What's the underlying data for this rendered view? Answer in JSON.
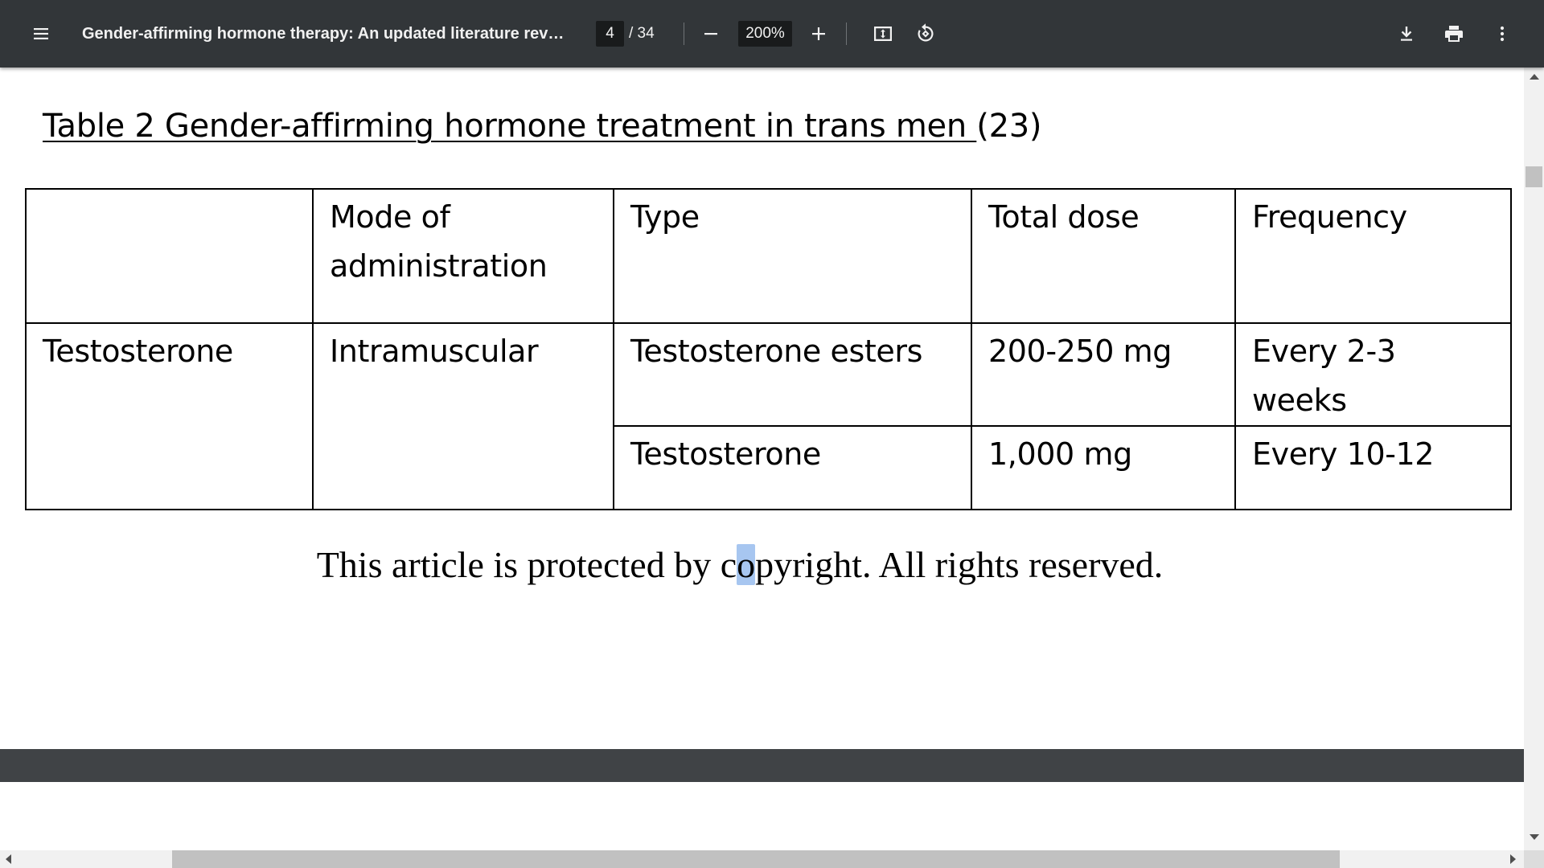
{
  "toolbar": {
    "menu_icon": "hamburger-menu-icon",
    "title": "Gender-affirming hormone therapy: An updated literature revie...",
    "page_current": "4",
    "page_total": "/ 34",
    "zoom_out_icon": "minus-icon",
    "zoom_value": "200%",
    "zoom_in_icon": "plus-icon",
    "fit_icon": "fit-to-page-icon",
    "rotate_icon": "rotate-counterclockwise-icon",
    "download_icon": "download-icon",
    "print_icon": "print-icon",
    "more_icon": "more-vertical-icon"
  },
  "document": {
    "caption_underlined": "Table 2 Gender-affirming hormone treatment in trans men ",
    "caption_ref": "(23)",
    "table": {
      "headers": [
        "",
        "Mode of administration",
        "Type",
        "Total dose",
        "Frequency"
      ],
      "rows": [
        {
          "hormone": "Testosterone",
          "mode": "Intramuscular",
          "type": "Testosterone esters",
          "dose": "200-250 mg",
          "frequency": "Every 2-3 weeks"
        },
        {
          "type": "Testosterone",
          "dose": "1,000 mg",
          "frequency": "Every 10-12"
        }
      ]
    },
    "copyright_before": "This article is protected by c",
    "copyright_selected": "o",
    "copyright_after": "pyright. All rights reserved."
  },
  "colors": {
    "toolbar_bg": "#323639",
    "viewer_bg": "#525659",
    "selection": "#a7c6f0"
  }
}
